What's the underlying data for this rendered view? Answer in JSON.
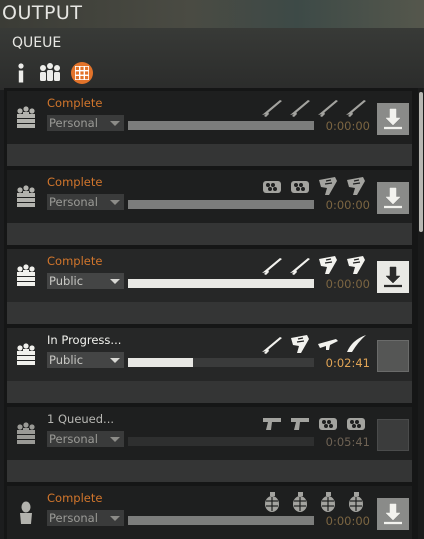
{
  "window": {
    "title": "OUTPUT",
    "section": "QUEUE"
  },
  "filters": [
    {
      "icon": "info-icon",
      "active": false
    },
    {
      "icon": "group-icon",
      "active": false
    },
    {
      "icon": "grid-icon",
      "active": true,
      "color": "#e2732a"
    }
  ],
  "cards": [
    {
      "status": "Complete",
      "status_color": "orange",
      "visibility": "Personal",
      "progress": 1.0,
      "time": "0:00:00",
      "type_icon": "crate-stack-icon",
      "items": [
        "rifle-icon",
        "rifle-icon",
        "rifle-icon",
        "rifle-icon"
      ],
      "action": "download"
    },
    {
      "status": "Complete",
      "status_color": "orange",
      "visibility": "Personal",
      "progress": 1.0,
      "time": "0:00:00",
      "type_icon": "crate-stack-icon",
      "items": [
        "ammo-crate-icon",
        "ammo-crate-icon",
        "ammo-magazine-icon",
        "ammo-magazine-icon"
      ],
      "action": "download"
    },
    {
      "status": "Complete",
      "status_color": "orange",
      "visibility": "Public",
      "progress": 1.0,
      "time": "0:00:00",
      "type_icon": "crate-stack-icon",
      "items": [
        "rifle-icon",
        "rifle-icon",
        "ammo-magazine-icon",
        "ammo-magazine-icon"
      ],
      "action": "download"
    },
    {
      "status": "In Progress...",
      "status_color": "white",
      "visibility": "Public",
      "progress": 0.35,
      "time": "0:02:41",
      "type_icon": "crate-stack-icon",
      "items": [
        "rifle-icon",
        "ammo-magazine-icon",
        "smg-icon",
        "bayonet-icon"
      ],
      "action": "empty"
    },
    {
      "status": "1 Queued...",
      "status_color": "gray",
      "visibility": "Personal",
      "progress": 0.0,
      "time": "0:05:41",
      "type_icon": "crate-stack-icon",
      "items": [
        "pistol-icon",
        "pistol-icon",
        "ammo-crate-icon",
        "ammo-crate-icon"
      ],
      "action": "empty"
    },
    {
      "status": "Complete",
      "status_color": "orange",
      "visibility": "Personal",
      "progress": 1.0,
      "time": "0:00:00",
      "type_icon": "soldier-icon",
      "items": [
        "grenade-icon",
        "grenade-icon",
        "grenade-icon",
        "grenade-icon"
      ],
      "action": "download"
    }
  ]
}
